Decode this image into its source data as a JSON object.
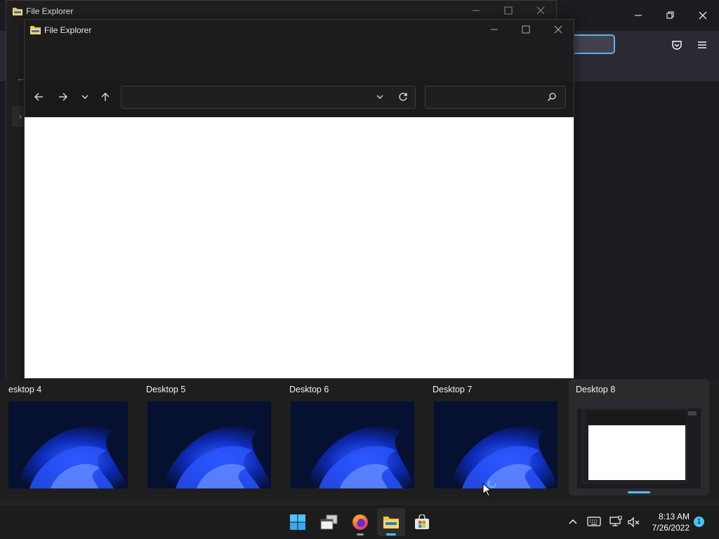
{
  "background_window": {
    "app": "Firefox",
    "controls": {
      "minimize": "—",
      "restore": "❐",
      "close": "✕"
    }
  },
  "back_explorer": {
    "title": "File Explorer",
    "icon": "folder-icon"
  },
  "explorer": {
    "title": "File Explorer",
    "icon": "folder-icon",
    "address_value": "",
    "search_value": ""
  },
  "desktops": [
    {
      "label": "esktop 4"
    },
    {
      "label": "Desktop 5"
    },
    {
      "label": "Desktop 6"
    },
    {
      "label": "Desktop 7"
    },
    {
      "label": "Desktop 8",
      "active": true
    }
  ],
  "taskbar": {
    "apps": [
      "start-icon",
      "task-view-icon",
      "firefox-icon",
      "file-explorer-icon",
      "store-icon"
    ]
  },
  "tray": {
    "time": "8:13 AM",
    "date": "7/26/2022",
    "notifications": "1"
  },
  "colors": {
    "accent": "#4cc2ff",
    "wallpaper_dark": "#071233",
    "wallpaper_blue": "#1a3cff"
  }
}
